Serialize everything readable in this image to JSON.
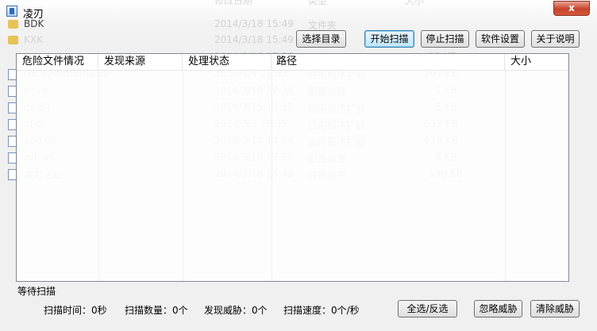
{
  "window": {
    "title": "凌刃",
    "close_glyph": "x",
    "icon": "app-shield-icon"
  },
  "background_listing": {
    "headers": {
      "date": "修改日期",
      "type": "类型",
      "size": "大小"
    },
    "rows": [
      {
        "name": "BDK",
        "date": "2014/3/18 15:49",
        "type": "文件夹",
        "size": "",
        "icon": "folder-icon"
      },
      {
        "name": "KXK",
        "date": "2014/3/18 15:49",
        "type": "文件夹",
        "size": "",
        "icon": "folder-icon"
      },
      {
        "name": "",
        "date": "2014/3/16 17:38",
        "type": "K 文件",
        "size": "12 KB",
        "icon": "file-icon"
      },
      {
        "name": "GetSystemInfo.dll",
        "date": "2010/4/4 21:33",
        "type": "应用程序扩展",
        "size": "202 KB",
        "icon": "dll-icon"
      },
      {
        "name": "pz.ini",
        "date": "2014/3/16 17:36",
        "type": "配置设置",
        "size": "1 KB",
        "icon": "ini-icon"
      },
      {
        "name": "qc.dll",
        "date": "2014/3/15 13:52",
        "type": "应用程序扩展",
        "size": "5 KB",
        "icon": "dll-icon"
      },
      {
        "name": "qf.dll",
        "date": "2014/3/5 18:35",
        "type": "应用程序扩展",
        "size": "632 KB",
        "icon": "dll-icon"
      },
      {
        "name": "ypd.dll",
        "date": "2014/3/14 14:04",
        "type": "应用程序扩展",
        "size": "628 KB",
        "icon": "dll-icon"
      },
      {
        "name": "zcb.ini",
        "date": "2014/3/16 17:38",
        "type": "配置设置",
        "size": "4 KB",
        "icon": "ini-icon"
      },
      {
        "name": "凌刃.exe",
        "date": "2014/3/18 15:49",
        "type": "应用程序",
        "size": "130 KB",
        "icon": "exe-icon"
      }
    ]
  },
  "toolbar": {
    "select_dir": "选择目录",
    "start_scan": "开始扫描",
    "stop_scan": "停止扫描",
    "settings": "软件设置",
    "about": "关于说明"
  },
  "table": {
    "columns": [
      "危险文件情况",
      "发现来源",
      "处理状态",
      "路径",
      "大小"
    ],
    "rows": []
  },
  "status": {
    "text": "等待扫描",
    "scan_time": "扫描时间：0秒",
    "scan_count": "扫描数量：0个",
    "threats_found": "发现威胁：0个",
    "scan_speed": "扫描速度：0个/秒"
  },
  "actions": {
    "select_all": "全选/反选",
    "ignore": "忽略威胁",
    "clear": "清除威胁"
  }
}
